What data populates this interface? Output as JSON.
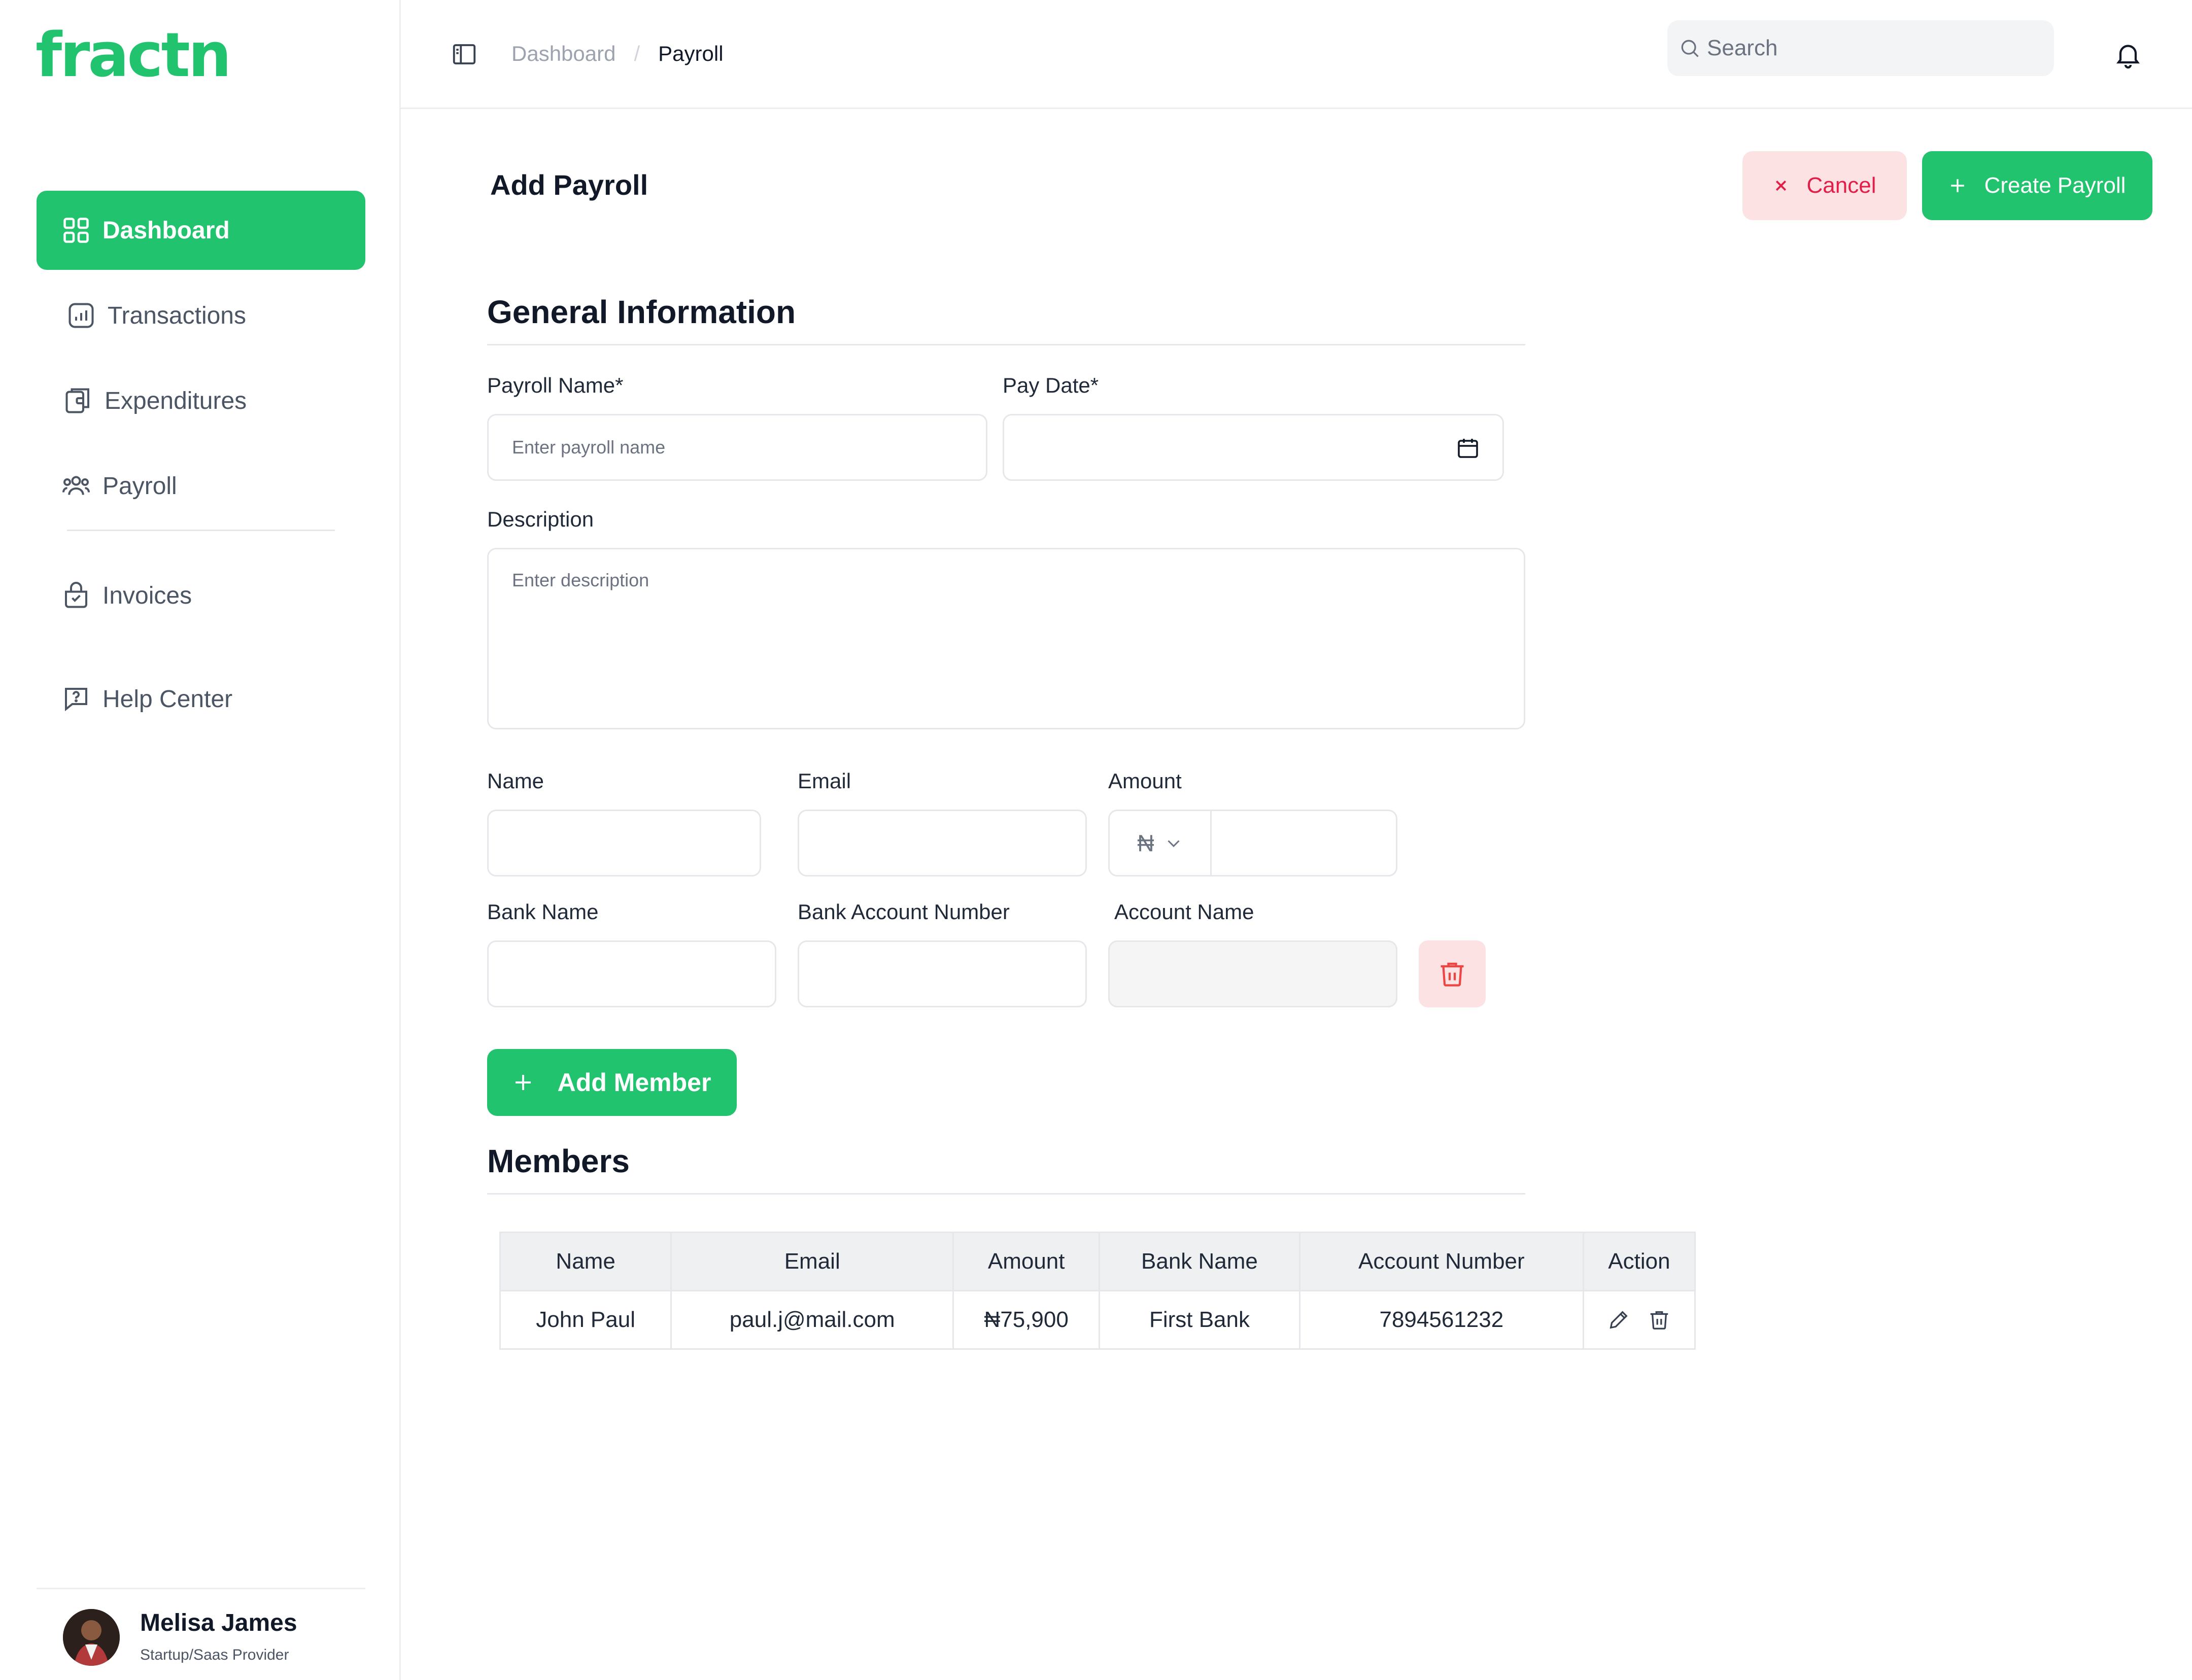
{
  "brand": {
    "logo_text": "fractn",
    "accent": "#22c36e"
  },
  "sidebar": {
    "items": [
      {
        "label": "Dashboard",
        "icon": "grid-icon",
        "active": true
      },
      {
        "label": "Transactions",
        "icon": "chart-icon"
      },
      {
        "label": "Expenditures",
        "icon": "wallet-icon"
      },
      {
        "label": "Payroll",
        "icon": "users-icon"
      },
      {
        "label": "Invoices",
        "icon": "invoice-bag-icon"
      },
      {
        "label": "Help Center",
        "icon": "help-chat-icon"
      }
    ],
    "profile": {
      "name": "Melisa James",
      "role": "Startup/Saas Provider"
    }
  },
  "topbar": {
    "breadcrumb": [
      "Dashboard",
      "/",
      "Payroll"
    ],
    "search_placeholder": "Search"
  },
  "header": {
    "title": "Add Payroll",
    "cancel_label": "Cancel",
    "create_label": "Create Payroll"
  },
  "general": {
    "title": "General Information",
    "payroll_name_label": "Payroll Name*",
    "payroll_name_placeholder": "Enter payroll name",
    "pay_date_label": "Pay Date*",
    "description_label": "Description",
    "description_placeholder": "Enter description"
  },
  "member_form": {
    "name_label": "Name",
    "email_label": "Email",
    "amount_label": "Amount",
    "currency": "₦",
    "bank_name_label": "Bank Name",
    "bank_account_label": "Bank Account Number",
    "account_name_label": "Account Name",
    "add_member_label": "Add Member"
  },
  "members": {
    "title": "Members",
    "columns": [
      "Name",
      "Email",
      "Amount",
      "Bank Name",
      "Account Number",
      "Action"
    ],
    "rows": [
      [
        "John Paul",
        "paul.j@mail.com",
        "₦75,900",
        "First Bank",
        "7894561232"
      ]
    ]
  }
}
